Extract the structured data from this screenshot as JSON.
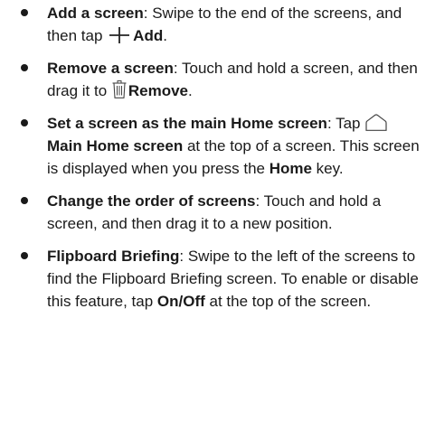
{
  "items": [
    {
      "term": "Add a screen",
      "text1": ": Swipe to the end of the screens, and then tap ",
      "icon": "plus-icon",
      "bold1": "Add",
      "text2": "."
    },
    {
      "term": "Remove a screen",
      "text1": ": Touch and hold a screen, and then drag it to ",
      "icon": "trash-icon",
      "bold1": "Remove",
      "text2": "."
    },
    {
      "term": "Set a screen as the main Home screen",
      "text1": ": Tap ",
      "icon": "home-icon",
      "bold1": "Main Home screen",
      "text2": " at the top of a screen. This screen is displayed when you press the ",
      "bold2": "Home",
      "text3": " key."
    },
    {
      "term": "Change the order of screens",
      "text1": ": Touch and hold a screen, and then drag it to a new position."
    },
    {
      "term": "Flipboard Briefing",
      "text1": ": Swipe to the left of the screens to find the Flipboard Briefing screen. To enable or disable this feature, tap ",
      "bold1": "On/Off",
      "text2": " at the top of the screen."
    }
  ]
}
